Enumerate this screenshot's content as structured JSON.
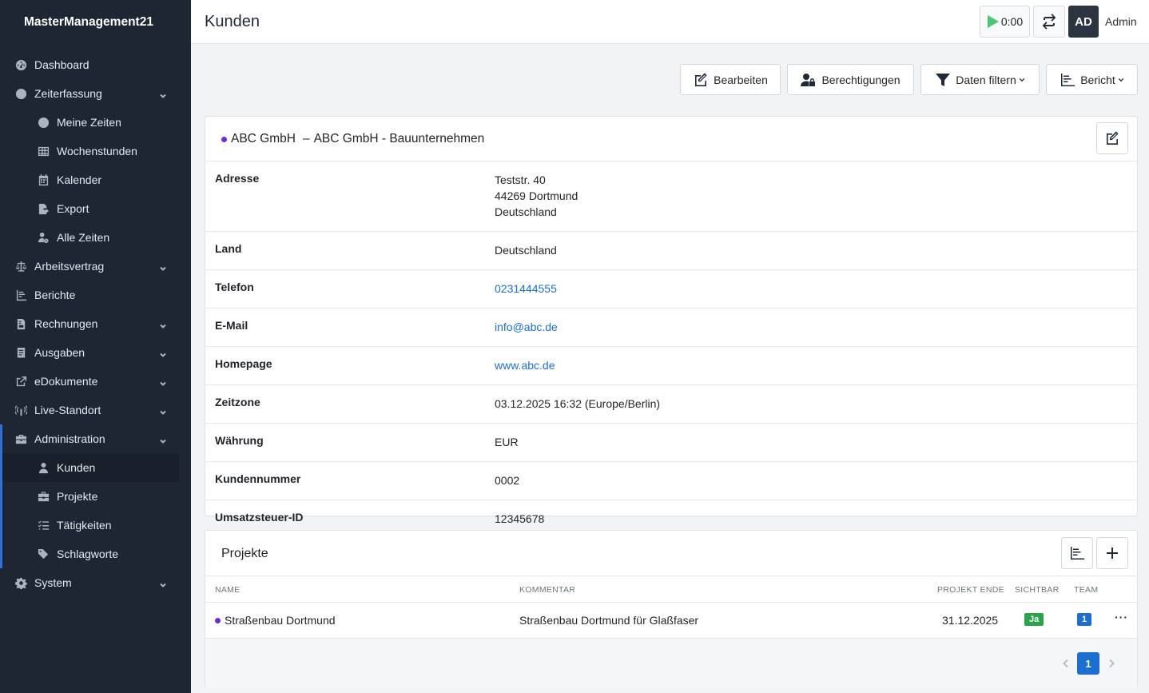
{
  "sidebar": {
    "brand": "MasterManagement21",
    "items": [
      {
        "label": "Dashboard",
        "icon": "dashboard-icon"
      },
      {
        "label": "Zeiterfassung",
        "icon": "clock-icon",
        "expandable": true
      },
      {
        "label": "Meine Zeiten",
        "icon": "clock-icon"
      },
      {
        "label": "Wochenstunden",
        "icon": "table-icon"
      },
      {
        "label": "Kalender",
        "icon": "calendar-icon"
      },
      {
        "label": "Export",
        "icon": "file-export-icon"
      },
      {
        "label": "Alle Zeiten",
        "icon": "user-clock-icon"
      },
      {
        "label": "Arbeitsvertrag",
        "icon": "scale-icon",
        "expandable": true
      },
      {
        "label": "Berichte",
        "icon": "chart-icon"
      },
      {
        "label": "Rechnungen",
        "icon": "invoice-icon",
        "expandable": true
      },
      {
        "label": "Ausgaben",
        "icon": "receipt-icon",
        "expandable": true
      },
      {
        "label": "eDokumente",
        "icon": "external-link-icon",
        "expandable": true
      },
      {
        "label": "Live-Standort",
        "icon": "broadcast-icon",
        "expandable": true
      },
      {
        "label": "Administration",
        "icon": "toolbox-icon",
        "expandable": true
      },
      {
        "label": "Kunden",
        "icon": "user-icon"
      },
      {
        "label": "Projekte",
        "icon": "briefcase-icon"
      },
      {
        "label": "Tätigkeiten",
        "icon": "list-check-icon"
      },
      {
        "label": "Schlagworte",
        "icon": "tags-icon"
      },
      {
        "label": "System",
        "icon": "gear-icon",
        "expandable": true
      }
    ]
  },
  "header": {
    "title": "Kunden",
    "timer": "0:00",
    "avatar_initials": "AD",
    "user_name": "Admin"
  },
  "toolbar": {
    "edit_label": "Bearbeiten",
    "permissions_label": "Berechtigungen",
    "filter_label": "Daten filtern",
    "report_label": "Bericht"
  },
  "customer": {
    "name": "ABC GmbH",
    "separator": "–",
    "full_title": "ABC GmbH - Bauunternehmen",
    "fields": {
      "address_label": "Adresse",
      "address_line1": "Teststr. 40",
      "address_line2": "44269 Dortmund",
      "address_line3": "Deutschland",
      "country_label": "Land",
      "country": "Deutschland",
      "phone_label": "Telefon",
      "phone": "0231444555",
      "email_label": "E-Mail",
      "email": "info@abc.de",
      "homepage_label": "Homepage",
      "homepage": "www.abc.de",
      "timezone_label": "Zeitzone",
      "timezone": "03.12.2025 16:32 (Europe/Berlin)",
      "currency_label": "Währung",
      "currency": "EUR",
      "customer_no_label": "Kundennummer",
      "customer_no": "0002",
      "vat_label": "Umsatzsteuer-ID",
      "vat": "12345678"
    }
  },
  "projects": {
    "title": "Projekte",
    "columns": {
      "name": "NAME",
      "comment": "KOMMENTAR",
      "end": "PROJEKT ENDE",
      "visible": "SICHTBAR",
      "team": "TEAM"
    },
    "rows": [
      {
        "name": "Straßenbau Dortmund",
        "comment": "Straßenbau Dortmund für Glaßfaser",
        "end": "31.12.2025",
        "visible": "Ja",
        "team": "1",
        "more": "···"
      }
    ],
    "pagination": {
      "current": "1"
    }
  },
  "colors": {
    "sidebar_bg": "#1e2634",
    "accent": "#1a6fd1",
    "customer_dot": "#6b2be0",
    "badge_green": "#2aa44a",
    "play_green": "#48c774"
  }
}
